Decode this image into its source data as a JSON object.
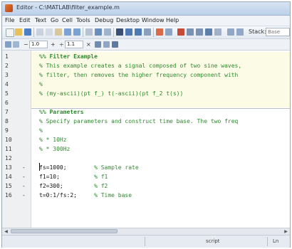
{
  "window": {
    "title": "Editor - C:\\MATLAB\\filter_example.m"
  },
  "menu": [
    "File",
    "Edit",
    "Text",
    "Go",
    "Cell",
    "Tools",
    "Debug",
    "Desktop",
    "Window",
    "Help"
  ],
  "toolbar": {
    "stack_label": "Stack:",
    "stack_value": "Base"
  },
  "cellbar": {
    "minus_label": "−",
    "value1": "1.0",
    "plus_label": "+",
    "divide_label": "÷",
    "value2": "1.1",
    "times_label": "×"
  },
  "editor": {
    "lines": [
      {
        "number": "1",
        "dash": "",
        "text": "%% Filter Example",
        "style": "comment-bold"
      },
      {
        "number": "2",
        "dash": "",
        "text": "% This example creates a signal composed of two sine waves,",
        "style": "comment"
      },
      {
        "number": "3",
        "dash": "",
        "text": "% filter, then removes the higher frequency component with",
        "style": "comment"
      },
      {
        "number": "4",
        "dash": "",
        "text": "%",
        "style": "comment"
      },
      {
        "number": "5",
        "dash": "",
        "text": "% (my-ascii)(pt f_) t(-ascii)(pt f_2 t(s))",
        "style": "comment"
      },
      {
        "number": "6",
        "dash": "",
        "text": "",
        "style": "code"
      },
      {
        "number": "7",
        "dash": "",
        "text": "%% Parameters",
        "style": "comment-bold"
      },
      {
        "number": "8",
        "dash": "",
        "text": "% Specify parameters and construct time base. The two freq",
        "style": "comment"
      },
      {
        "number": "9",
        "dash": "",
        "text": "%",
        "style": "comment"
      },
      {
        "number": "10",
        "dash": "",
        "text": "% * 10Hz",
        "style": "comment"
      },
      {
        "number": "11",
        "dash": "",
        "text": "% * 300Hz",
        "style": "comment"
      },
      {
        "number": "12",
        "dash": "",
        "text": "",
        "style": "code"
      },
      {
        "number": "13",
        "dash": "-",
        "text": "fs=1000;        % Sample rate",
        "style": "mixed"
      },
      {
        "number": "14",
        "dash": "-",
        "text": "f1=10;          % f1",
        "style": "mixed"
      },
      {
        "number": "15",
        "dash": "-",
        "text": "f2=300;         % f2",
        "style": "mixed"
      },
      {
        "number": "16",
        "dash": "-",
        "text": "t=0:1/fs:2;     % Time base",
        "style": "mixed"
      }
    ]
  },
  "status": {
    "mode": "script",
    "ln": "Ln"
  },
  "colors": {
    "comment": "#2f8a2f",
    "cell_band": "#fbfbe6",
    "title_bar": "#bcd0ea"
  }
}
